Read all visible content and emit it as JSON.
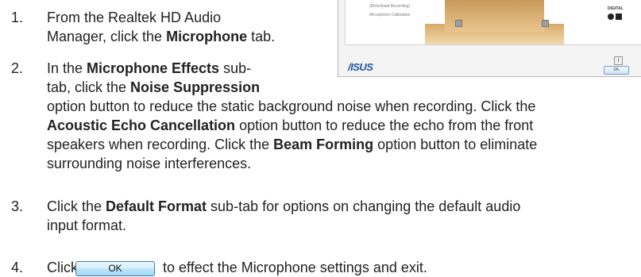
{
  "steps": [
    {
      "number": "1.",
      "lines": [
        {
          "parts": [
            "From the Realtek HD Audio"
          ]
        },
        {
          "parts": [
            "Manager, click the ",
            "Microphone",
            " tab."
          ]
        }
      ]
    },
    {
      "number": "2.",
      "lines": [
        {
          "parts": [
            "In the ",
            "Microphone Effects",
            " sub-"
          ]
        },
        {
          "parts": [
            "tab, click the ",
            "Noise Suppression"
          ]
        },
        {
          "parts": [
            "option button to reduce the static background noise when recording. Click the"
          ]
        },
        {
          "parts": [
            "Acoustic Echo Cancellation",
            " option button to reduce the echo from the front"
          ]
        },
        {
          "parts": [
            "speakers when recording. Click the ",
            "Beam Forming",
            " option button to eliminate"
          ]
        },
        {
          "parts": [
            "surrounding noise interferences."
          ]
        }
      ]
    },
    {
      "number": "3.",
      "lines": [
        {
          "parts": [
            "Click the ",
            "Default Format",
            " sub-tab for options on changing the default audio"
          ]
        },
        {
          "parts": [
            "input format."
          ]
        }
      ]
    },
    {
      "number": "4.",
      "lines": [
        {
          "parts": [
            "Click",
            "to effect the Microphone settings and exit."
          ]
        }
      ]
    }
  ],
  "ok_button_label": "OK",
  "screenshot": {
    "logo_text": "/ISUS",
    "digital_label": "DIGITAL",
    "ok_label": "OK",
    "info_label": "i",
    "left_labels": [
      "(Directional Recording)",
      "Microphone Calibration"
    ]
  }
}
